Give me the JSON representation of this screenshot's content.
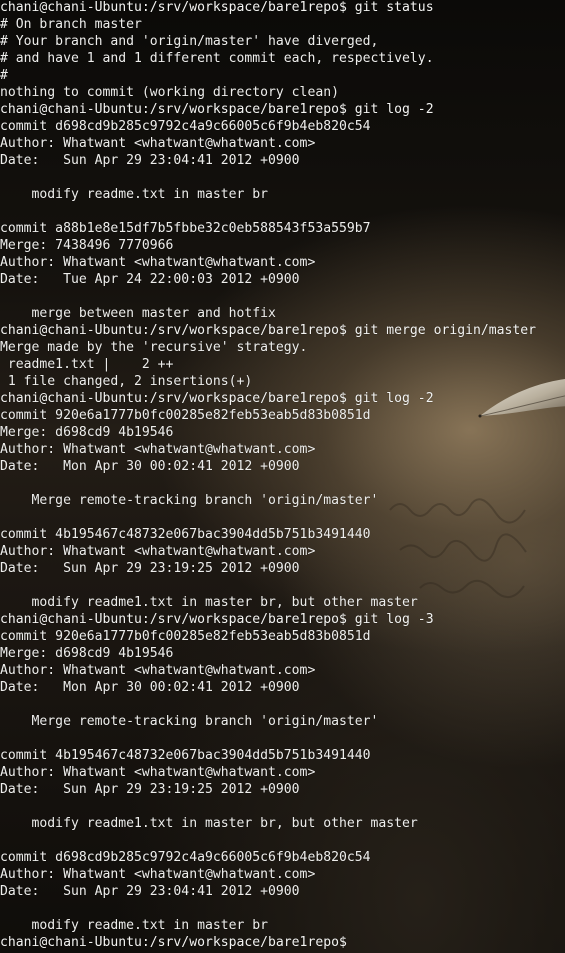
{
  "terminal": {
    "lines": [
      {
        "type": "prompt",
        "text": "chani@chani-Ubuntu:/srv/workspace/bare1repo$ git status"
      },
      {
        "type": "output",
        "text": "# On branch master"
      },
      {
        "type": "output",
        "text": "# Your branch and 'origin/master' have diverged,"
      },
      {
        "type": "output",
        "text": "# and have 1 and 1 different commit each, respectively."
      },
      {
        "type": "output",
        "text": "#"
      },
      {
        "type": "output",
        "text": "nothing to commit (working directory clean)"
      },
      {
        "type": "prompt",
        "text": "chani@chani-Ubuntu:/srv/workspace/bare1repo$ git log -2"
      },
      {
        "type": "output",
        "text": "commit d698cd9b285c9792c4a9c66005c6f9b4eb820c54"
      },
      {
        "type": "output",
        "text": "Author: Whatwant <whatwant@whatwant.com>"
      },
      {
        "type": "output",
        "text": "Date:   Sun Apr 29 23:04:41 2012 +0900"
      },
      {
        "type": "output",
        "text": ""
      },
      {
        "type": "output",
        "text": "    modify readme.txt in master br"
      },
      {
        "type": "output",
        "text": ""
      },
      {
        "type": "output",
        "text": "commit a88b1e8e15df7b5fbbe32c0eb588543f53a559b7"
      },
      {
        "type": "output",
        "text": "Merge: 7438496 7770966"
      },
      {
        "type": "output",
        "text": "Author: Whatwant <whatwant@whatwant.com>"
      },
      {
        "type": "output",
        "text": "Date:   Tue Apr 24 22:00:03 2012 +0900"
      },
      {
        "type": "output",
        "text": ""
      },
      {
        "type": "output",
        "text": "    merge between master and hotfix"
      },
      {
        "type": "prompt",
        "text": "chani@chani-Ubuntu:/srv/workspace/bare1repo$ git merge origin/master"
      },
      {
        "type": "output",
        "text": "Merge made by the 'recursive' strategy."
      },
      {
        "type": "output",
        "text": " readme1.txt |    2 ++"
      },
      {
        "type": "output",
        "text": " 1 file changed, 2 insertions(+)"
      },
      {
        "type": "prompt",
        "text": "chani@chani-Ubuntu:/srv/workspace/bare1repo$ git log -2"
      },
      {
        "type": "output",
        "text": "commit 920e6a1777b0fc00285e82feb53eab5d83b0851d"
      },
      {
        "type": "output",
        "text": "Merge: d698cd9 4b19546"
      },
      {
        "type": "output",
        "text": "Author: Whatwant <whatwant@whatwant.com>"
      },
      {
        "type": "output",
        "text": "Date:   Mon Apr 30 00:02:41 2012 +0900"
      },
      {
        "type": "output",
        "text": ""
      },
      {
        "type": "output",
        "text": "    Merge remote-tracking branch 'origin/master'"
      },
      {
        "type": "output",
        "text": ""
      },
      {
        "type": "output",
        "text": "commit 4b195467c48732e067bac3904dd5b751b3491440"
      },
      {
        "type": "output",
        "text": "Author: Whatwant <whatwant@whatwant.com>"
      },
      {
        "type": "output",
        "text": "Date:   Sun Apr 29 23:19:25 2012 +0900"
      },
      {
        "type": "output",
        "text": ""
      },
      {
        "type": "output",
        "text": "    modify readme1.txt in master br, but other master"
      },
      {
        "type": "prompt",
        "text": "chani@chani-Ubuntu:/srv/workspace/bare1repo$ git log -3"
      },
      {
        "type": "output",
        "text": "commit 920e6a1777b0fc00285e82feb53eab5d83b0851d"
      },
      {
        "type": "output",
        "text": "Merge: d698cd9 4b19546"
      },
      {
        "type": "output",
        "text": "Author: Whatwant <whatwant@whatwant.com>"
      },
      {
        "type": "output",
        "text": "Date:   Mon Apr 30 00:02:41 2012 +0900"
      },
      {
        "type": "output",
        "text": ""
      },
      {
        "type": "output",
        "text": "    Merge remote-tracking branch 'origin/master'"
      },
      {
        "type": "output",
        "text": ""
      },
      {
        "type": "output",
        "text": "commit 4b195467c48732e067bac3904dd5b751b3491440"
      },
      {
        "type": "output",
        "text": "Author: Whatwant <whatwant@whatwant.com>"
      },
      {
        "type": "output",
        "text": "Date:   Sun Apr 29 23:19:25 2012 +0900"
      },
      {
        "type": "output",
        "text": ""
      },
      {
        "type": "output",
        "text": "    modify readme1.txt in master br, but other master"
      },
      {
        "type": "output",
        "text": ""
      },
      {
        "type": "output",
        "text": "commit d698cd9b285c9792c4a9c66005c6f9b4eb820c54"
      },
      {
        "type": "output",
        "text": "Author: Whatwant <whatwant@whatwant.com>"
      },
      {
        "type": "output",
        "text": "Date:   Sun Apr 29 23:04:41 2012 +0900"
      },
      {
        "type": "output",
        "text": ""
      },
      {
        "type": "output",
        "text": "    modify readme.txt in master br"
      },
      {
        "type": "prompt",
        "text": "chani@chani-Ubuntu:/srv/workspace/bare1repo$"
      }
    ]
  },
  "colors": {
    "text": "#eeeeec",
    "background": "#15120e"
  }
}
